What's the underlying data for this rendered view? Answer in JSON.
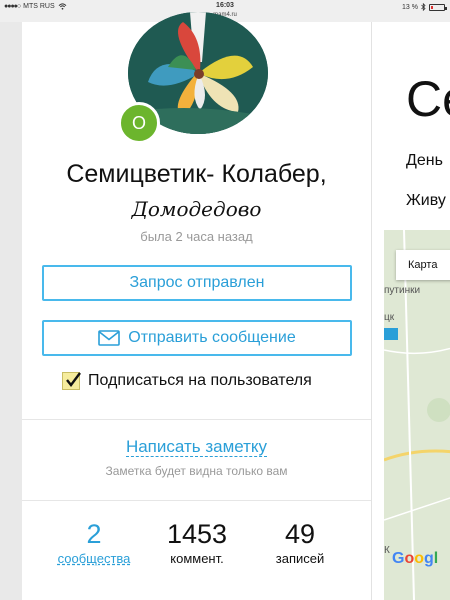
{
  "status_bar": {
    "carrier": "MTS RUS",
    "time": "16:03",
    "url": "mam4.ru",
    "battery": "13 %",
    "battery_level": 0.13
  },
  "profile": {
    "online_badge": "О",
    "name": "Семицветик- Колабер,",
    "city": "Домодедово",
    "last_seen": "была 2 часа назад",
    "request_button": "Запрос отправлен",
    "message_button": "Отправить сообщение",
    "subscribe_label": "Подписаться на пользователя",
    "subscribe_checked": true,
    "note_link": "Написать заметку",
    "note_hint": "Заметка будет видна только вам"
  },
  "stats": {
    "communities_count": "2",
    "communities_label": "сообщества",
    "comments_count": "1453",
    "comments_label": "коммент.",
    "posts_count": "49",
    "posts_label": "записей"
  },
  "right_panel": {
    "title": "Се",
    "line1": "День",
    "line2": "Живу",
    "map_type_button": "Карта",
    "map_text_1": "путинки",
    "map_text_2": "цк",
    "map_text_3": "К",
    "map_brand": "Google"
  },
  "colors": {
    "accent": "#2a9fd8",
    "button_border": "#49b9ec",
    "online": "#6cb52d",
    "checkbox": "#f6ec9d"
  },
  "icons": {
    "wifi": "wifi-icon",
    "signal": "signal-dots-icon",
    "bluetooth": "bluetooth-icon",
    "battery": "battery-icon",
    "mail": "envelope-icon",
    "check": "checkmark-icon"
  }
}
